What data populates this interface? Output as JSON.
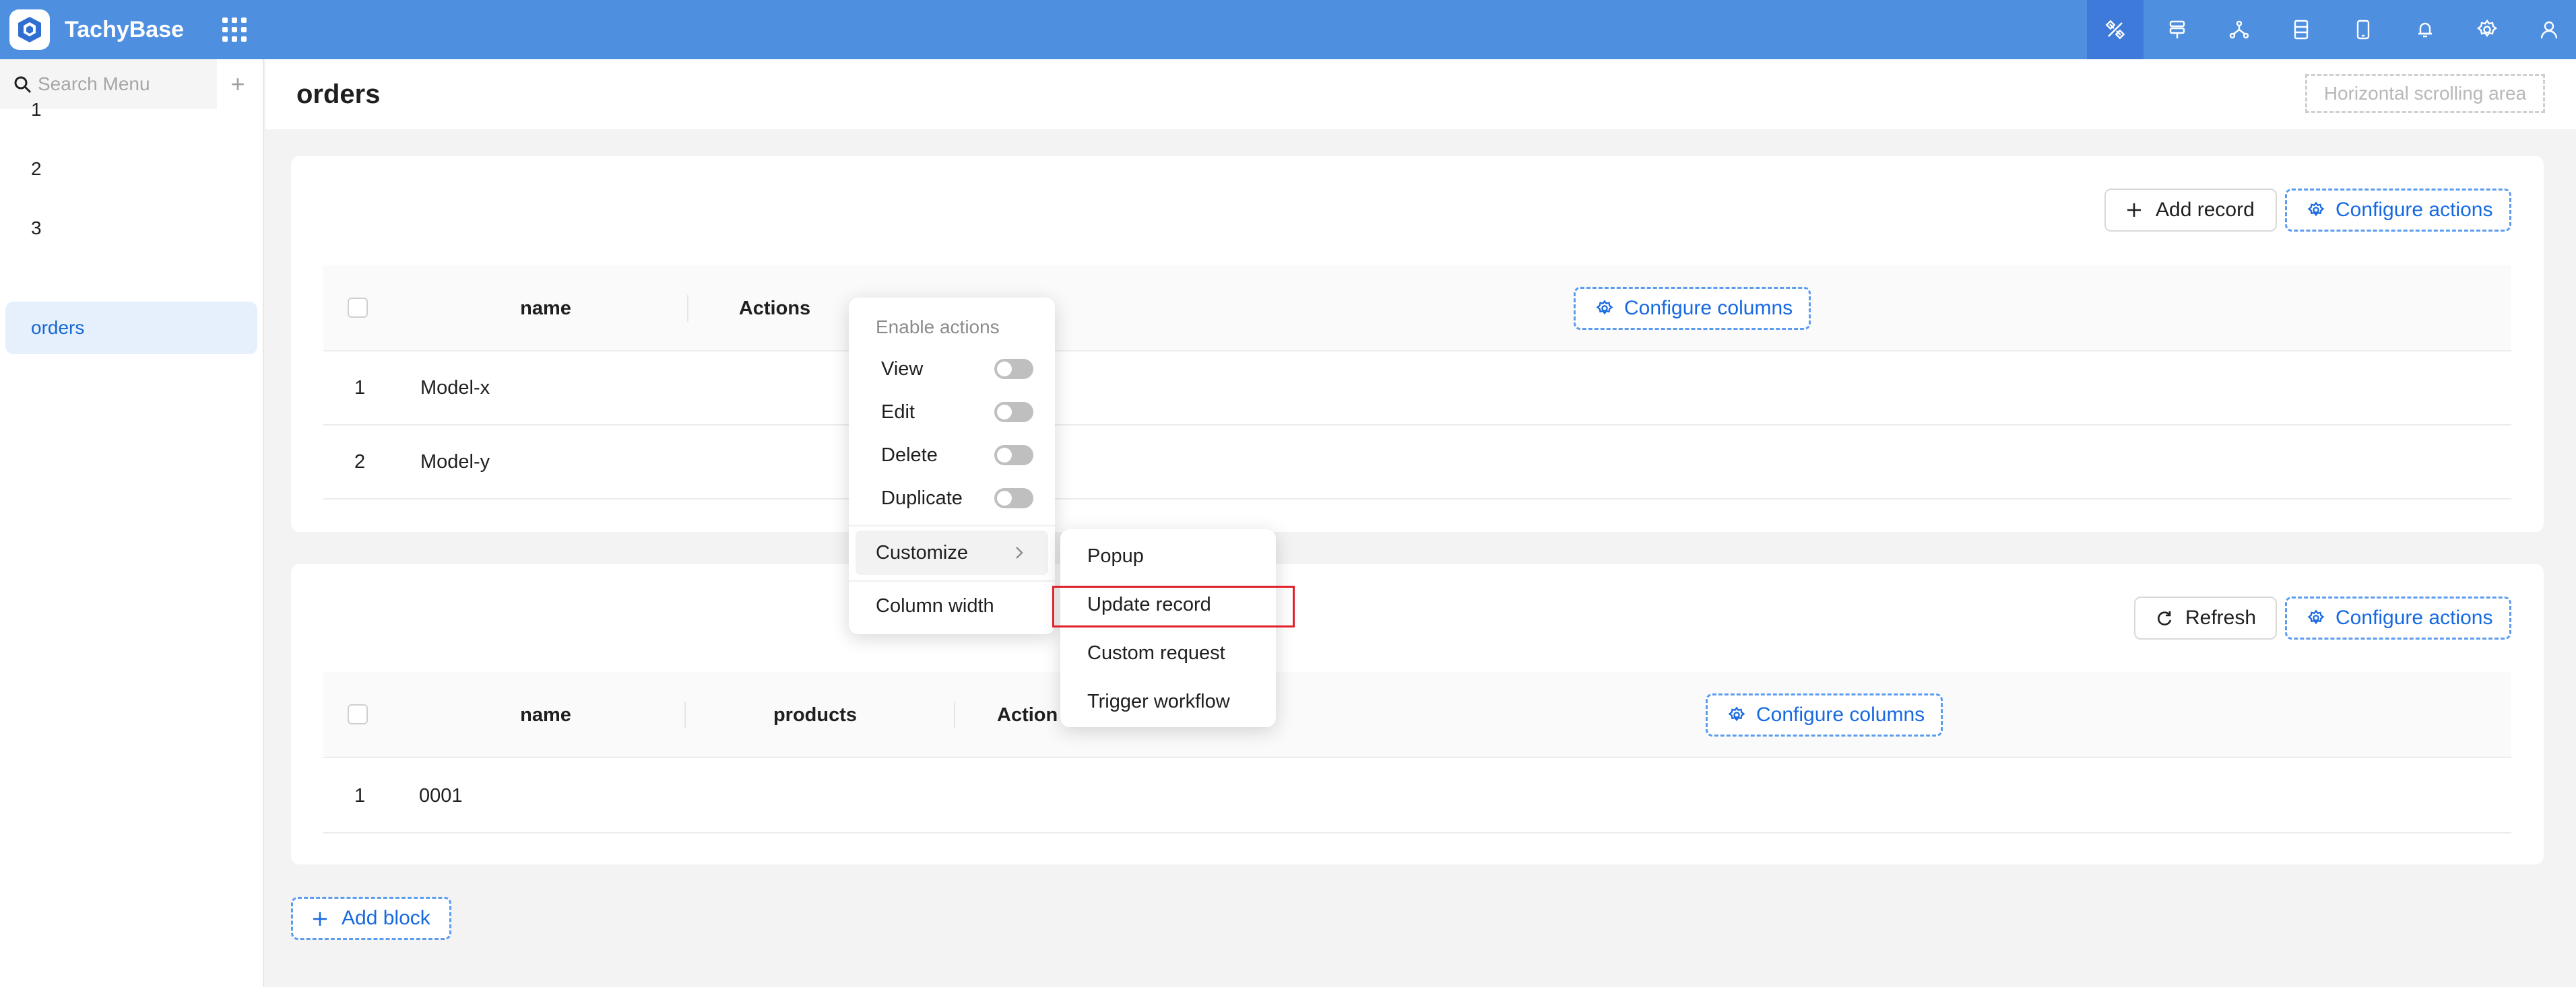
{
  "header": {
    "app_title": "TachyBase",
    "icons": [
      "ui-editor-icon",
      "route-icon",
      "workflow-icon",
      "collection-icon",
      "mobile-icon",
      "bell-icon",
      "gear-icon",
      "user-icon"
    ]
  },
  "sidebar": {
    "search_placeholder": "Search Menu",
    "add_label": "+",
    "items": [
      {
        "label": "1"
      },
      {
        "label": "2"
      },
      {
        "label": "3"
      },
      {
        "label": "orders",
        "selected": true
      }
    ]
  },
  "topbar": {
    "title": "orders",
    "hscroll_label": "Horizontal scrolling area"
  },
  "block1": {
    "add_record": "Add record",
    "configure_actions": "Configure actions",
    "columns": [
      "name",
      "Actions"
    ],
    "configure_columns": "Configure columns",
    "rows": [
      {
        "index": "1",
        "name": "Model-x"
      },
      {
        "index": "2",
        "name": "Model-y"
      }
    ]
  },
  "block2": {
    "refresh": "Refresh",
    "configure_actions": "Configure actions",
    "columns": [
      "name",
      "products",
      "Action"
    ],
    "configure_columns": "Configure columns",
    "rows": [
      {
        "index": "1",
        "name": "0001"
      }
    ]
  },
  "add_block": "Add block",
  "dropdown": {
    "header": "Enable actions",
    "toggles": [
      {
        "label": "View",
        "on": false
      },
      {
        "label": "Edit",
        "on": false
      },
      {
        "label": "Delete",
        "on": false
      },
      {
        "label": "Duplicate",
        "on": false
      }
    ],
    "customize": "Customize",
    "column_width": "Column width"
  },
  "submenu": {
    "items": [
      "Popup",
      "Update record",
      "Custom request",
      "Trigger workflow"
    ],
    "highlighted": "Update record"
  },
  "colors": {
    "header_bg": "#4f8fe0",
    "accent": "#1767d2",
    "highlight_border": "#e0202a"
  }
}
